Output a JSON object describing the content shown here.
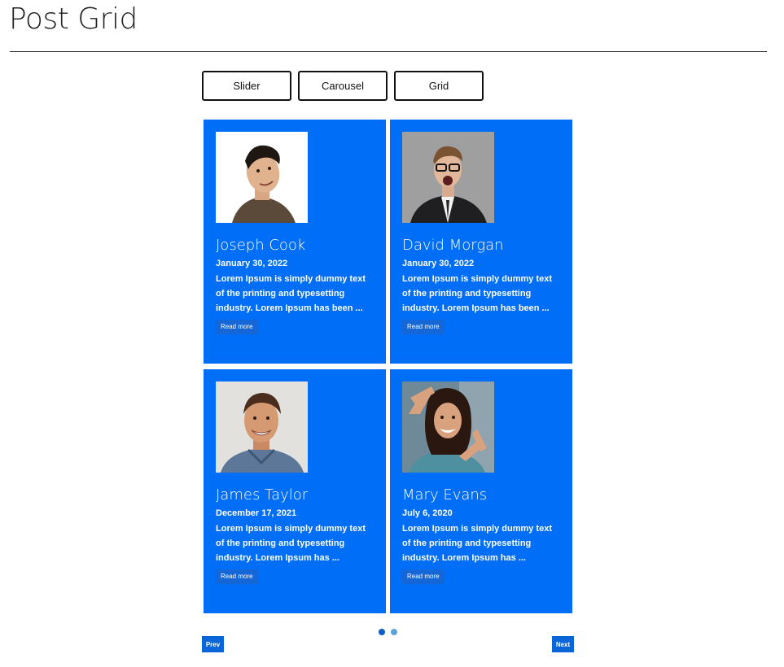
{
  "page": {
    "title": "Post Grid"
  },
  "view_buttons": [
    {
      "label": "Slider"
    },
    {
      "label": "Carousel"
    },
    {
      "label": "Grid"
    }
  ],
  "posts": [
    {
      "name": "Joseph Cook",
      "date": "January 30, 2022",
      "excerpt": "Lorem Ipsum is simply dummy text of the printing and typesetting industry. Lorem Ipsum has been ...",
      "read_more": "Read more"
    },
    {
      "name": "David Morgan",
      "date": "January 30, 2022",
      "excerpt": "Lorem Ipsum is simply dummy text of the printing and typesetting industry. Lorem Ipsum has been ...",
      "read_more": "Read more"
    },
    {
      "name": "James Taylor",
      "date": "December 17, 2021",
      "excerpt": "Lorem Ipsum is simply dummy text of the printing and typesetting industry. Lorem Ipsum has ...",
      "read_more": "Read more"
    },
    {
      "name": "Mary Evans",
      "date": "July 6, 2020",
      "excerpt": "Lorem Ipsum is simply dummy text of the printing and typesetting industry. Lorem Ipsum has ...",
      "read_more": "Read more"
    }
  ],
  "pagination": {
    "prev_label": "Prev",
    "next_label": "Next",
    "dots": [
      {
        "active": true,
        "color": "#0a5fc4"
      },
      {
        "active": false,
        "color": "#5fa3dd"
      }
    ]
  },
  "colors": {
    "card_background": "#006ef6",
    "read_more_background": "#1566d6",
    "nav_button_background": "#0a66d8"
  }
}
